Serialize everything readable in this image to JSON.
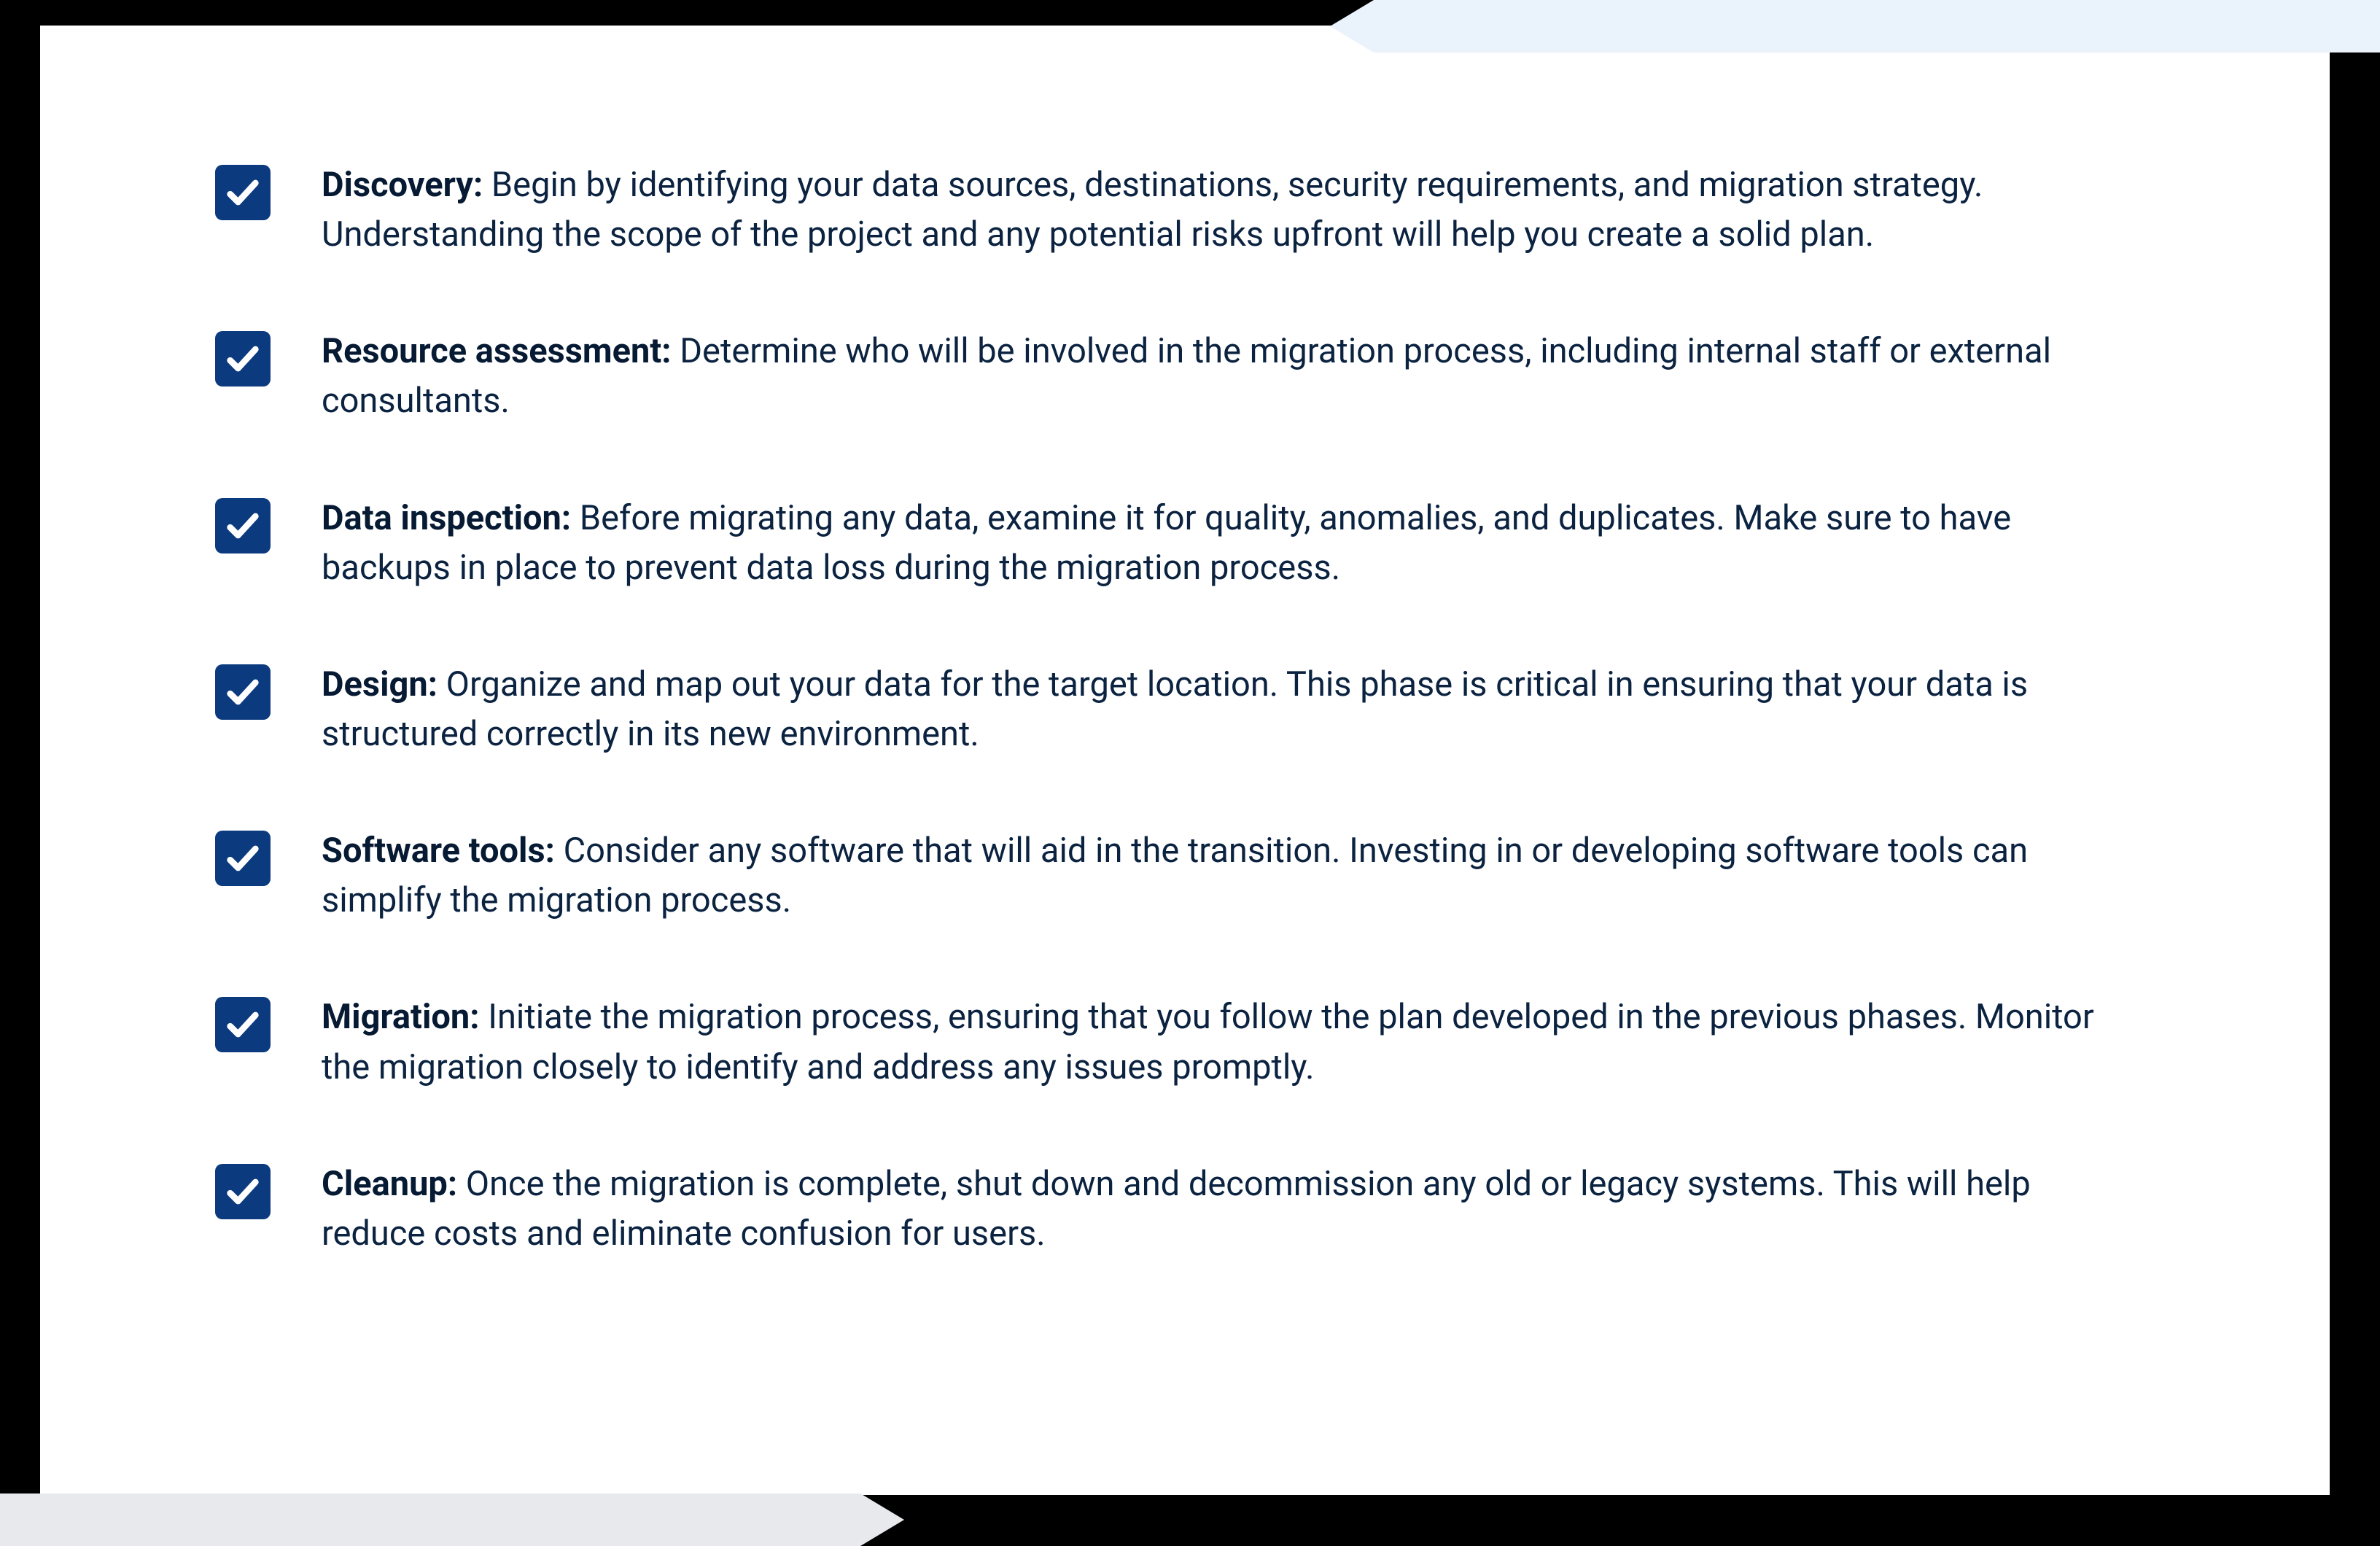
{
  "colors": {
    "checkbox_bg": "#0B3A7E",
    "text": "#0B2340",
    "title": "#061A33",
    "top_arrow": "#EAF2FB",
    "bottom_arrow": "#E7E9EC"
  },
  "items": [
    {
      "title": "Discovery:",
      "body": "Begin by identifying your data sources, destinations, security requirements, and migration strategy. Understanding the scope of the project and any potential risks upfront will help you create a solid plan."
    },
    {
      "title": "Resource assessment:",
      "body": "Determine who will be involved in the migration process, including internal staff or external consultants."
    },
    {
      "title": "Data inspection:",
      "body": "Before migrating any data, examine it for quality, anomalies, and duplicates. Make sure to have backups in place to prevent data loss during the migration process."
    },
    {
      "title": "Design:",
      "body": "Organize and map out your data for the target location. This phase is critical in ensuring that your data is structured correctly in its new environment."
    },
    {
      "title": "Software tools:",
      "body": "Consider any software that will aid in the transition. Investing in or developing software tools can simplify the migration process."
    },
    {
      "title": "Migration:",
      "body": "Initiate the migration process, ensuring that you follow the plan developed in the previous phases. Monitor the migration closely to identify and address any issues promptly."
    },
    {
      "title": "Cleanup:",
      "body": "Once the migration is complete, shut down and decommission any old or legacy systems. This will help reduce costs and eliminate confusion for users."
    }
  ]
}
